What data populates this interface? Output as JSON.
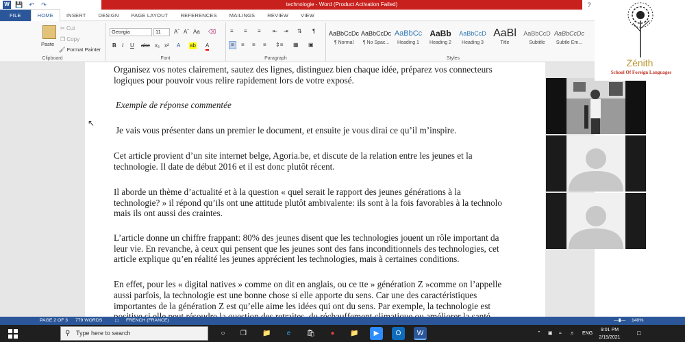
{
  "window": {
    "title": "technologie - Word (Product Activation Failed)",
    "help": "?"
  },
  "ribbon_tabs": [
    "FILE",
    "HOME",
    "INSERT",
    "DESIGN",
    "PAGE LAYOUT",
    "REFERENCES",
    "MAILINGS",
    "REVIEW",
    "VIEW"
  ],
  "clipboard": {
    "paste": "Paste",
    "cut": "Cut",
    "copy": "Copy",
    "format_painter": "Format Painter",
    "group": "Clipboard"
  },
  "font": {
    "name": "Georgia",
    "size": "11",
    "group": "Font"
  },
  "paragraph": {
    "group": "Paragraph"
  },
  "styles": {
    "group": "Styles",
    "items": [
      {
        "preview": "AaBbCcDc",
        "name": "¶ Normal"
      },
      {
        "preview": "AaBbCcDc",
        "name": "¶ No Spac..."
      },
      {
        "preview": "AaBbCc",
        "name": "Heading 1"
      },
      {
        "preview": "AaBb",
        "name": "Heading 2"
      },
      {
        "preview": "AaBbCcD",
        "name": "Heading 3"
      },
      {
        "preview": "AaBl",
        "name": "Title"
      },
      {
        "preview": "AaBbCcD",
        "name": "Subtitle"
      },
      {
        "preview": "AaBbCcDc",
        "name": "Subtle Em..."
      }
    ]
  },
  "document": {
    "lines": [
      "Organisez vos notes clairement, sautez des lignes, distinguez bien chaque idée, préparez vos connecteurs",
      "logiques pour pouvoir vous relire rapidement lors de votre exposé.",
      "Exemple de réponse commentée",
      "Je vais vous présenter dans un premier le document, et ensuite je vous dirai ce qu’il m’inspire.",
      "Cet article provient d’un site internet belge, Agoria.be, et discute de la relation entre les jeunes et la",
      "technologie. Il date de début 2016 et il est donc plutôt récent.",
      "Il aborde un thème d’actualité et à la question « quel serait le rapport des jeunes générations à la",
      "technologie? » il répond qu’ils ont une attitude plutôt ambivalente: ils sont à la fois favorables à la technolo",
      "mais ils ont aussi des craintes.",
      "L’article donne un chiffre frappant: 80% des jeunes disent que les technologies jouent un rôle important da",
      "leur vie. En revanche, à ceux qui pensent que les jeunes sont des fans inconditionnels des technologies, cet",
      "article explique qu’en réalité les jeunes apprécient les technologies, mais à certaines conditions.",
      "En effet, pour les « digital natives » comme on dit en anglais, ou ce tte  » génération Z »comme on l’appelle",
      "aussi parfois, la technologie est une bonne chose si elle apporte du sens. Car une des caractéristiques",
      "importantes de la génération Z est qu’elle aime les idées qui ont du sens. Par exemple, la technologie est",
      "positive si elle peut résoudre la question des retraites, du réchauffement climatique ou améliorer la santé"
    ]
  },
  "status": {
    "page": "PAGE 2 OF 3",
    "words": "779 WORDS",
    "language": "FRENCH (FRANCE)",
    "zoom": "140%"
  },
  "taskbar": {
    "search_placeholder": "Type here to search",
    "time": "9:01 PM",
    "date": "2/15/2021",
    "lang": "ENG"
  },
  "logo": {
    "name": "Zénith",
    "tagline": "School Of Foreign Languages"
  },
  "colors": {
    "word_blue": "#2b579a",
    "activation_red": "#c8201c"
  }
}
